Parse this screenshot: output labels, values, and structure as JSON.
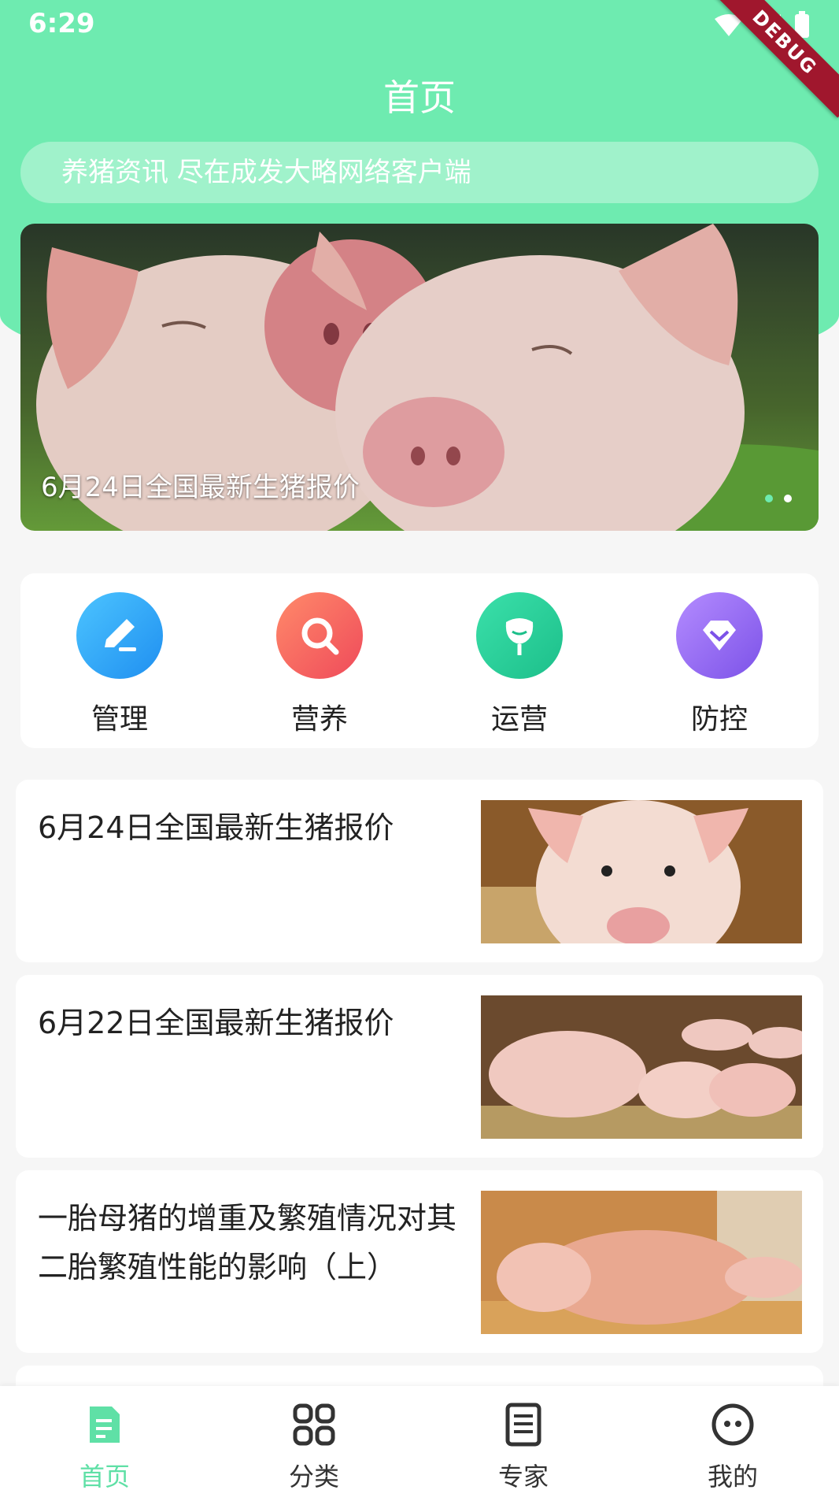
{
  "status_bar": {
    "time": "6:29",
    "debug_label": "DEBUG"
  },
  "header": {
    "title": "首页",
    "search_placeholder": "养猪资讯 尽在成发大略网络客户端"
  },
  "banner": {
    "caption": "6月24日全国最新生猪报价",
    "dots": 2,
    "active_dot": 0
  },
  "categories": [
    {
      "label": "管理",
      "icon": "edit-icon",
      "color": "#2aa7f5"
    },
    {
      "label": "营养",
      "icon": "search-icon",
      "color": "#f25c5c"
    },
    {
      "label": "运营",
      "icon": "flower-icon",
      "color": "#2bd39b"
    },
    {
      "label": "防控",
      "icon": "diamond-icon",
      "color": "#9a6af0"
    }
  ],
  "news": [
    {
      "title": "6月24日全国最新生猪报价"
    },
    {
      "title": "6月22日全国最新生猪报价"
    },
    {
      "title": "一胎母猪的增重及繁殖情况对其二胎繁殖性能的影响（上）"
    }
  ],
  "tabbar": {
    "items": [
      {
        "label": "首页",
        "icon": "document-icon",
        "active": true
      },
      {
        "label": "分类",
        "icon": "grid-icon",
        "active": false
      },
      {
        "label": "专家",
        "icon": "list-icon",
        "active": false
      },
      {
        "label": "我的",
        "icon": "face-icon",
        "active": false
      }
    ]
  },
  "colors": {
    "accent": "#6eebb0",
    "active_tab": "#5fe0a6"
  }
}
